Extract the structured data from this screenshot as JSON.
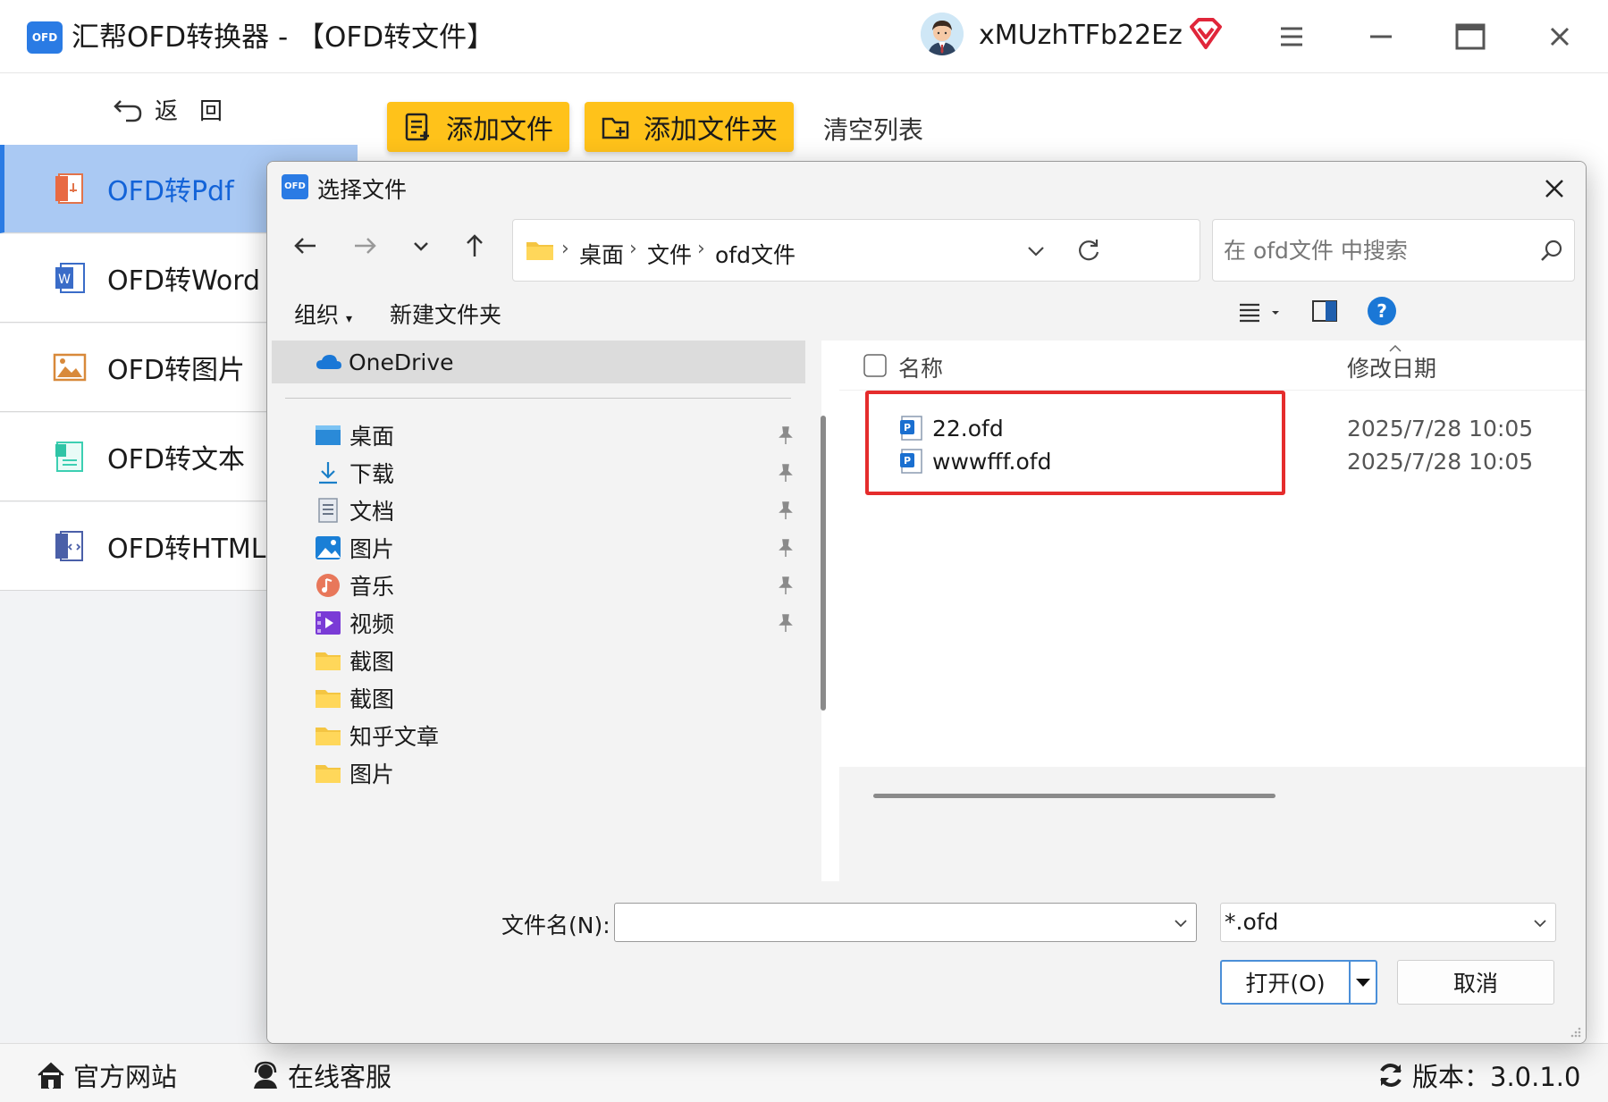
{
  "app": {
    "logo_text": "OFD",
    "title": "汇帮OFD转换器 - 【OFD转文件】",
    "username": "xMUzhTFb22Ez"
  },
  "sidebar": {
    "back_label": "返回",
    "items": [
      {
        "label": "OFD转Pdf",
        "active": true
      },
      {
        "label": "OFD转Word",
        "active": false
      },
      {
        "label": "OFD转图片",
        "active": false
      },
      {
        "label": "OFD转文本",
        "active": false
      },
      {
        "label": "OFD转HTML",
        "active": false
      }
    ]
  },
  "toolbar": {
    "add_file": "添加文件",
    "add_folder": "添加文件夹",
    "clear_list": "清空列表"
  },
  "footer": {
    "website": "官方网站",
    "support": "在线客服",
    "version": "版本：3.0.1.0"
  },
  "dialog": {
    "logo_text": "OFD",
    "title": "选择文件",
    "breadcrumbs": [
      "桌面",
      "文件",
      "ofd文件"
    ],
    "search_placeholder": "在 ofd文件 中搜索",
    "commands": {
      "organize": "组织",
      "new_folder": "新建文件夹"
    },
    "nav_pane": {
      "onedrive": "OneDrive",
      "items": [
        {
          "label": "桌面",
          "icon": "desktop-icon",
          "pinned": true
        },
        {
          "label": "下载",
          "icon": "download-icon",
          "pinned": true
        },
        {
          "label": "文档",
          "icon": "document-icon",
          "pinned": true
        },
        {
          "label": "图片",
          "icon": "pictures-icon",
          "pinned": true
        },
        {
          "label": "音乐",
          "icon": "music-icon",
          "pinned": true
        },
        {
          "label": "视频",
          "icon": "video-icon",
          "pinned": true
        },
        {
          "label": "截图",
          "icon": "folder-icon",
          "pinned": false
        },
        {
          "label": "截图",
          "icon": "folder-icon",
          "pinned": false
        },
        {
          "label": "知乎文章",
          "icon": "folder-icon",
          "pinned": false
        },
        {
          "label": "图片",
          "icon": "folder-icon",
          "pinned": false
        }
      ]
    },
    "columns": {
      "name": "名称",
      "modified": "修改日期"
    },
    "files": [
      {
        "name": "22.ofd",
        "modified": "2025/7/28 10:05"
      },
      {
        "name": "wwwfff.ofd",
        "modified": "2025/7/28 10:05"
      }
    ],
    "filename_label": "文件名(N):",
    "filename_value": "",
    "filetype": "*.ofd",
    "open_button": "打开(O)",
    "cancel_button": "取消"
  },
  "colors": {
    "accent": "#2a7be4",
    "button_yellow": "#ffc21a",
    "sidebar_active_bg": "#aac9f3",
    "highlight_red": "#e52c2c"
  }
}
